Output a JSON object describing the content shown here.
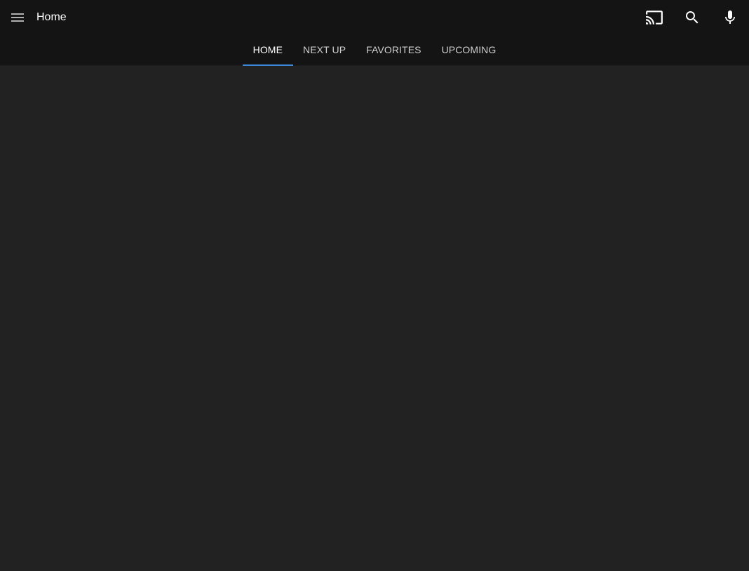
{
  "header": {
    "title": "Home",
    "icons": {
      "menu": "menu-icon",
      "cast": "cast-icon",
      "search": "search-icon",
      "mic": "mic-icon"
    }
  },
  "tabs": [
    {
      "label": "HOME",
      "active": true
    },
    {
      "label": "NEXT UP",
      "active": false
    },
    {
      "label": "FAVORITES",
      "active": false
    },
    {
      "label": "UPCOMING",
      "active": false
    }
  ],
  "colors": {
    "header_bg": "#141414",
    "content_bg": "#222222",
    "tab_indicator": "#3d86d6",
    "text_primary": "#ffffff",
    "text_secondary": "#d0d0d0"
  }
}
